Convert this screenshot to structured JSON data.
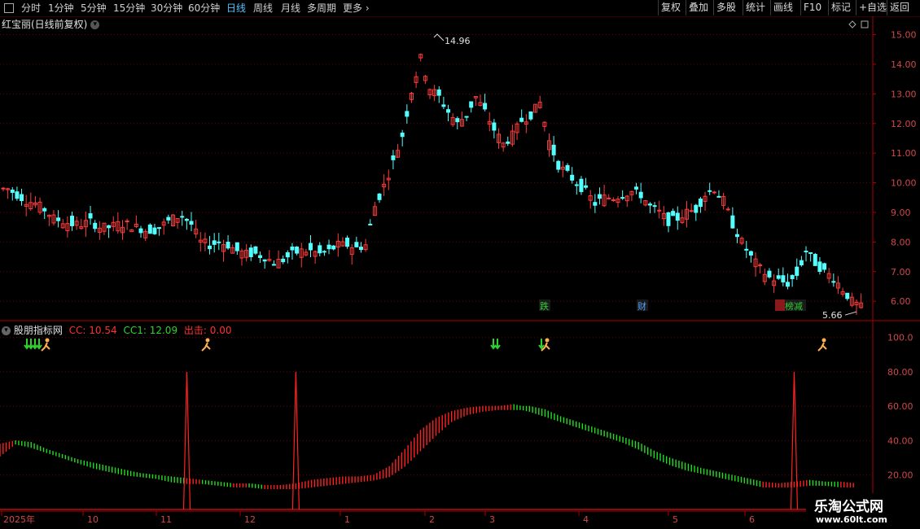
{
  "toolbar": {
    "periods": [
      "分时",
      "1分钟",
      "5分钟",
      "15分钟",
      "30分钟",
      "60分钟",
      "日线",
      "周线",
      "月线",
      "多周期",
      "更多"
    ],
    "active_period": "日线",
    "right_buttons": [
      "复权",
      "叠加",
      "多股",
      "统计",
      "画线",
      "F10",
      "标记",
      "+自选",
      "返回"
    ]
  },
  "main_chart": {
    "title": "红宝丽(日线前复权)",
    "high_label": "14.96",
    "low_label": "5.66",
    "y_ticks": [
      "15.00",
      "14.00",
      "13.00",
      "12.00",
      "11.00",
      "10.00",
      "9.00",
      "8.00",
      "7.00",
      "6.00"
    ],
    "tags": [
      {
        "text": "跌",
        "color": "#2fd12f"
      },
      {
        "text": "财",
        "color": "#4f9fff"
      },
      {
        "text": "张榜减",
        "color": "#2fd12f"
      }
    ]
  },
  "indicator": {
    "name": "股朋指标网",
    "cc": "CC: 10.54",
    "cc1": "CC1: 12.09",
    "chuji": "出击: 0.00",
    "y_ticks": [
      "100.0",
      "80.00",
      "60.00",
      "40.00",
      "20.00"
    ]
  },
  "x_axis": {
    "labels": [
      "2025年",
      "10",
      "11",
      "12",
      "1",
      "2",
      "3",
      "4",
      "5",
      "6"
    ]
  },
  "watermark": {
    "line1": "乐淘公式网",
    "line2": "www.60lt.com"
  },
  "colors": {
    "up": "#ff3b3b",
    "down": "#54ffff",
    "grid": "#6a0000",
    "axis": "#b00000",
    "band_up": "#ff2020",
    "band_down": "#20e020"
  },
  "chart_data": {
    "type": "candlestick",
    "price_range": [
      5.4,
      15.4
    ],
    "indicator_range": [
      0,
      105
    ],
    "close_path": [
      9.8,
      9.6,
      9.4,
      9.3,
      9.1,
      8.8,
      8.7,
      8.6,
      8.6,
      8.7,
      8.5,
      8.5,
      8.6,
      8.6,
      8.5,
      8.4,
      8.4,
      8.6,
      8.8,
      8.9,
      8.6,
      8.0,
      7.9,
      8.0,
      7.9,
      7.7,
      7.6,
      7.6,
      7.5,
      7.3,
      7.4,
      7.6,
      7.7,
      7.7,
      7.6,
      7.7,
      7.9,
      7.9,
      7.8,
      7.9,
      9.2,
      9.9,
      10.7,
      11.6,
      13.1,
      14.2,
      13.2,
      12.9,
      12.4,
      12.0,
      12.3,
      12.9,
      12.4,
      11.8,
      11.3,
      11.6,
      12.1,
      12.3,
      12.7,
      11.4,
      10.6,
      10.3,
      10.0,
      9.7,
      9.3,
      9.5,
      9.5,
      9.6,
      9.7,
      9.6,
      9.2,
      9.0,
      8.7,
      8.8,
      9.0,
      9.1,
      9.6,
      9.8,
      9.4,
      8.6,
      8.0,
      7.5,
      7.1,
      6.8,
      6.7,
      6.6,
      6.9,
      7.7,
      7.3,
      7.0,
      6.8,
      6.4,
      6.0,
      5.8
    ],
    "indicator_fast": [
      32,
      39,
      38,
      34,
      31,
      28,
      25,
      23,
      21,
      20,
      19,
      17,
      16,
      16,
      15,
      14,
      14,
      13,
      13,
      14,
      16,
      17,
      18,
      18,
      19,
      24,
      34,
      45,
      52,
      56,
      58,
      59,
      59,
      60,
      58,
      55,
      52,
      49,
      46,
      43,
      40,
      36,
      31,
      27,
      24,
      22,
      20,
      18,
      16,
      14,
      14,
      15,
      16,
      15,
      14,
      14
    ],
    "indicator_slow": [
      37,
      39,
      37,
      34,
      31,
      28,
      26,
      24,
      22,
      20,
      19,
      18,
      17,
      16,
      15,
      14,
      14,
      13,
      13,
      13,
      14,
      15,
      16,
      17,
      18,
      20,
      26,
      35,
      44,
      52,
      56,
      58,
      59,
      59,
      59,
      57,
      53,
      50,
      47,
      44,
      41,
      38,
      33,
      29,
      26,
      23,
      21,
      19,
      17,
      15,
      14,
      14,
      15,
      15,
      15,
      14
    ],
    "spikes": [
      {
        "x_index": 12,
        "value": 80
      },
      {
        "x_index": 19,
        "value": 80
      },
      {
        "x_index": 51,
        "value": 80
      }
    ]
  }
}
